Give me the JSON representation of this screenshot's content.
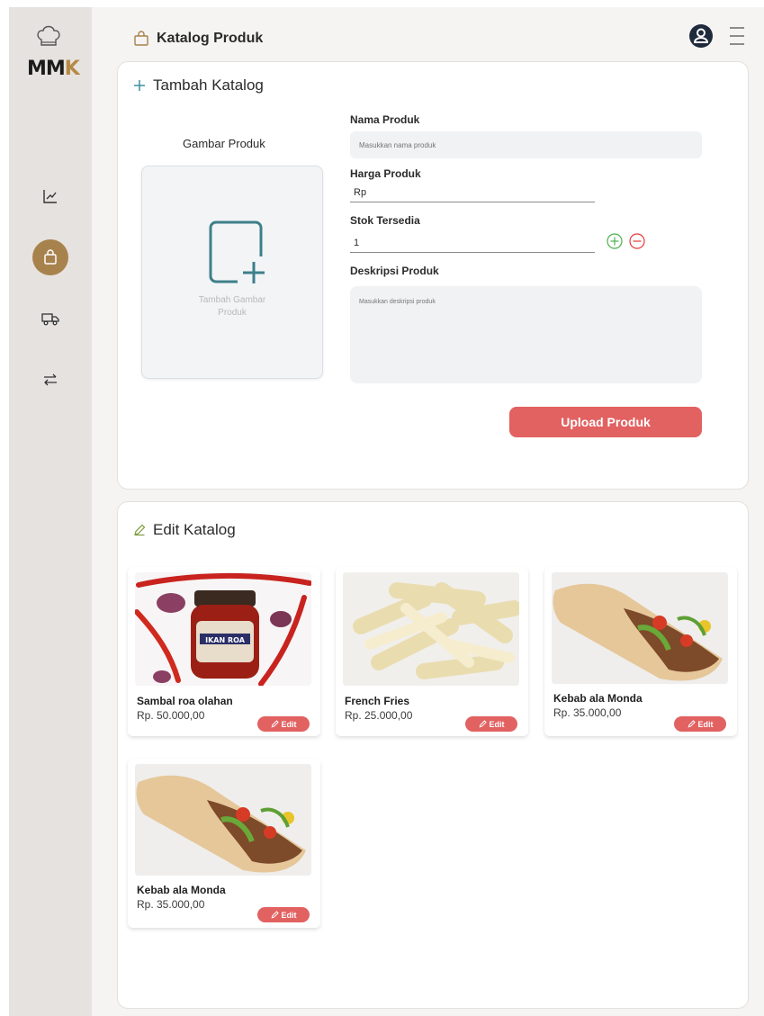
{
  "app": {
    "logo_text_m": "MM",
    "logo_text_k": "K"
  },
  "header": {
    "title": "Katalog Produk"
  },
  "sidebar": {
    "items": [
      {
        "icon": "chart-icon",
        "active": false
      },
      {
        "icon": "bag-icon",
        "active": true
      },
      {
        "icon": "truck-icon",
        "active": false
      },
      {
        "icon": "transfer-icon",
        "active": false
      }
    ]
  },
  "add_section": {
    "title": "Tambah Katalog",
    "image_label": "Gambar Produk",
    "image_placeholder_line1": "Tambah Gambar",
    "image_placeholder_line2": "Produk",
    "name_label": "Nama Produk",
    "name_placeholder": "Masukkan nama produk",
    "price_label": "Harga Produk",
    "price_value": "Rp",
    "stock_label": "Stok Tersedia",
    "stock_value": "1",
    "desc_label": "Deskripsi Produk",
    "desc_placeholder": "Masukkan deskripsi produk",
    "upload_label": "Upload Produk"
  },
  "edit_section": {
    "title": "Edit Katalog",
    "edit_label": "Edit",
    "products": [
      {
        "name": "Sambal roa olahan",
        "price": "Rp. 50.000,00",
        "image": "sambal"
      },
      {
        "name": "French Fries",
        "price": "Rp. 25.000,00",
        "image": "fries"
      },
      {
        "name": "Kebab ala Monda",
        "price": "Rp. 35.000,00",
        "image": "kebab"
      },
      {
        "name": "Kebab ala Monda",
        "price": "Rp. 35.000,00",
        "image": "kebab"
      }
    ]
  },
  "colors": {
    "accent": "#e26161",
    "brand": "#a8824d",
    "plus_green": "#4caf50",
    "minus_red": "#e53935"
  }
}
